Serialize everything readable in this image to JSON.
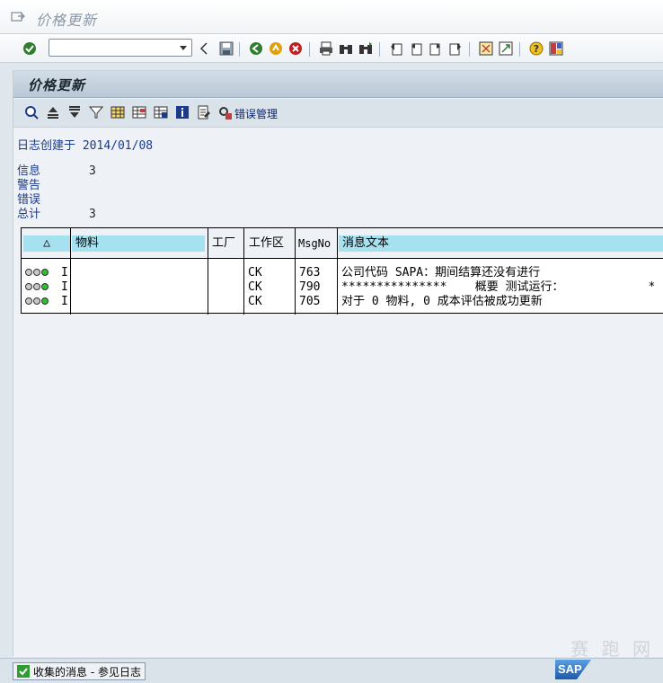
{
  "window": {
    "title": "价格更新"
  },
  "std_toolbar": {
    "command_field_placeholder": "",
    "icons": [
      "enter-icon",
      "dropdown-icon",
      "back-nav-icon",
      "save-icon",
      "back-icon",
      "exit-icon",
      "cancel-icon",
      "print-icon",
      "find-icon",
      "find-next-icon",
      "first-page-icon",
      "prev-page-icon",
      "next-page-icon",
      "last-page-icon",
      "new-session-icon",
      "shortcut-icon",
      "help-icon",
      "layout-icon"
    ]
  },
  "screen": {
    "header": "价格更新",
    "app_toolbar": {
      "error_management_label": "错误管理"
    },
    "log_created_label": "日志创建于",
    "log_created_date": "2014/01/08",
    "stats": [
      {
        "label": "信息",
        "value": "3"
      },
      {
        "label": "警告",
        "value": ""
      },
      {
        "label": "错误",
        "value": ""
      },
      {
        "label": "总计",
        "value": "3"
      }
    ],
    "table": {
      "headers": {
        "status": "△",
        "material": "物料",
        "plant": "工厂",
        "work_area": "工作区",
        "msgno": "MsgNo",
        "msgtext": "消息文本"
      },
      "rows": [
        {
          "type": "I",
          "material": "",
          "plant": "",
          "work_area": "CK",
          "msgno": "763",
          "msgtext": "公司代码 SAPA：期间结算还没有进行"
        },
        {
          "type": "I",
          "material": "",
          "plant": "",
          "work_area": "CK",
          "msgno": "790",
          "msgtext": "***************    概要 测试运行：            *"
        },
        {
          "type": "I",
          "material": "",
          "plant": "",
          "work_area": "CK",
          "msgno": "705",
          "msgtext": "对于 0 物料, 0 成本评估被成功更新"
        }
      ]
    }
  },
  "statusbar": {
    "message": "收集的消息 - 参见日志"
  },
  "watermark": {
    "text": "赛 跑 网",
    "logo": "SAP"
  },
  "colors": {
    "header_blue": "#a6e1f0",
    "led_green": "#2fc02f",
    "led_off": "#c8c8c8"
  }
}
